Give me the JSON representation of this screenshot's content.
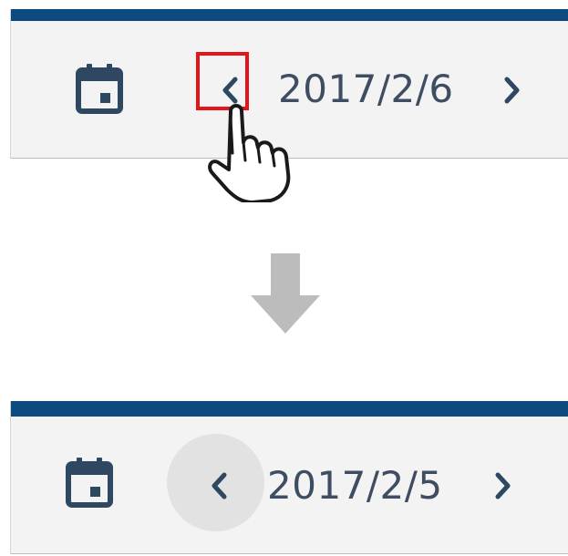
{
  "steps": [
    {
      "id": "before",
      "date_label": "2017/2/6",
      "calendar_icon": "calendar-icon",
      "prev_icon": "chevron-left-icon",
      "next_icon": "chevron-right-icon",
      "prev_highlighted": true,
      "prev_pressed": false
    },
    {
      "id": "after",
      "date_label": "2017/2/5",
      "calendar_icon": "calendar-icon",
      "prev_icon": "chevron-left-icon",
      "next_icon": "chevron-right-icon",
      "prev_highlighted": false,
      "prev_pressed": true
    }
  ],
  "annotations": {
    "highlight_color": "#e5141a",
    "pointer_icon": "hand-pointer-icon",
    "transition_icon": "down-arrow-icon"
  },
  "colors": {
    "header_accent": "#0c4a80",
    "toolbar_background": "#f3f3f3",
    "text": "#3e4d61",
    "ripple": "#e2e2e2",
    "transition_arrow": "#bcbcbc"
  }
}
